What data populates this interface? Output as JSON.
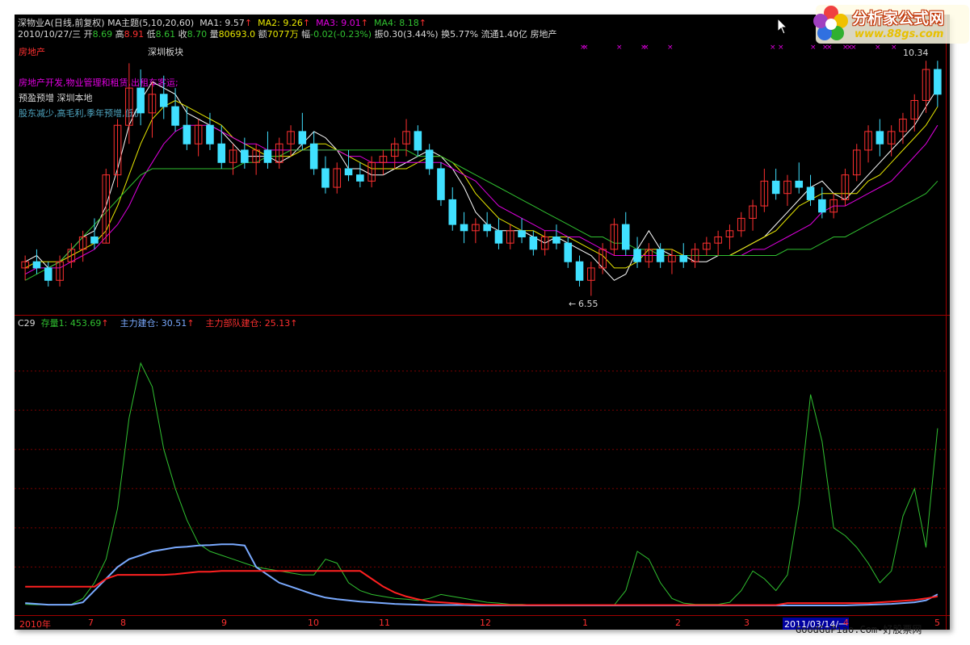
{
  "header": {
    "line1": [
      {
        "text": "深物业A(日线,前复权)",
        "color": "#d8d8d8"
      },
      {
        "text": "MA主题(5,10,20,60)",
        "color": "#d8d8d8"
      },
      {
        "text": "MA1: 9.57",
        "color": "#d8d8d8"
      },
      {
        "text": "MA2: 9.26",
        "color": "#e8e800"
      },
      {
        "text": "MA3: 9.01",
        "color": "#e000e0"
      },
      {
        "text": "MA4: 8.18",
        "color": "#30c030"
      }
    ],
    "line2": {
      "date": "2010/10/27/三",
      "open_label": "开",
      "open": "8.69",
      "high_label": "高",
      "high": "8.91",
      "low_label": "低",
      "low": "8.61",
      "close_label": "收",
      "close": "8.70",
      "vol_label": "量",
      "vol": "80693.0",
      "amt_label": "额",
      "amt": "7077万",
      "chg_label": "幅",
      "chg": "-0.02(-0.23%)",
      "amp_label": "振",
      "amp": "0.30(3.44%)",
      "turn_label": "换",
      "turn": "5.77%",
      "float_label": "流通",
      "float": "1.40亿",
      "industry": "房地产"
    }
  },
  "tags": {
    "sector": "房地产",
    "board": "深圳板块",
    "business": "房地产开发,物业管理和租赁,出租车客运;",
    "forecast": "预盈预增 深圳本地",
    "notes": "股东减少,高毛利,季年预增,低价"
  },
  "price_labels": {
    "high": "10.34",
    "low": "6.55"
  },
  "indicator_header": {
    "name": "C29",
    "stock_label": "存量1: 453.69",
    "main_label": "主力建仓: 30.51",
    "dept_label": "主力部队建仓: 25.13"
  },
  "x_axis": {
    "labels": [
      {
        "text": "2010年",
        "pos": 0
      },
      {
        "text": "7",
        "pos": 85
      },
      {
        "text": "8",
        "pos": 125
      },
      {
        "text": "9",
        "pos": 250
      },
      {
        "text": "10",
        "pos": 357
      },
      {
        "text": "11",
        "pos": 445
      },
      {
        "text": "12",
        "pos": 570
      },
      {
        "text": "1",
        "pos": 697
      },
      {
        "text": "2",
        "pos": 812
      },
      {
        "text": "3",
        "pos": 897
      },
      {
        "text": "2011/03/14/一",
        "pos": 945
      },
      {
        "text": "4",
        "pos": 1020
      },
      {
        "text": "5",
        "pos": 1133
      }
    ]
  },
  "logo": {
    "title": "分析家公式网",
    "url": "www.88gs.com"
  },
  "watermark": "GoodGuPiao.Com-好股票网",
  "colors": {
    "up": "#ff3030",
    "down": "#40e0ff",
    "ma1": "#ffffff",
    "ma2": "#e8e800",
    "ma3": "#e000e0",
    "ma4": "#30c030",
    "ind_stock": "#30c030",
    "ind_main": "#7aaaff",
    "ind_dept": "#ff2020",
    "grid": "#a00000"
  },
  "chart_data": [
    {
      "type": "candlestick",
      "title": "深物业A(日线,前复权)",
      "series": [
        {
          "name": "MA1",
          "values": [
            7.1,
            7.2,
            7.0,
            7.1,
            7.3,
            7.5,
            7.6,
            8.0,
            8.6,
            9.3,
            9.7,
            10.0,
            9.9,
            9.8,
            9.5,
            9.4,
            9.3,
            9.2,
            9.0,
            8.8,
            8.8,
            8.8,
            8.7,
            8.8,
            9.0,
            9.2,
            9.1,
            8.9,
            8.6,
            8.6,
            8.5,
            8.5,
            8.6,
            8.7,
            8.8,
            8.9,
            8.8,
            8.6,
            8.3,
            7.9,
            7.7,
            7.6,
            7.6,
            7.6,
            7.5,
            7.4,
            7.5,
            7.4,
            7.3,
            7.2,
            7.0,
            6.8,
            6.9,
            7.3,
            7.6,
            7.3,
            7.2,
            7.2,
            7.1,
            7.1,
            7.2,
            7.2,
            7.3,
            7.4,
            7.5,
            7.7,
            7.9,
            8.1,
            8.3,
            8.4,
            8.2,
            8.1,
            8.3,
            8.5,
            8.7,
            8.9,
            9.1,
            9.3,
            9.6,
            9.9
          ]
        },
        {
          "name": "MA2",
          "values": [
            7.0,
            7.1,
            7.1,
            7.1,
            7.2,
            7.3,
            7.4,
            7.6,
            8.0,
            8.5,
            9.0,
            9.4,
            9.6,
            9.7,
            9.6,
            9.5,
            9.4,
            9.3,
            9.1,
            9.0,
            8.9,
            8.8,
            8.8,
            8.8,
            8.9,
            9.0,
            9.0,
            8.9,
            8.8,
            8.7,
            8.6,
            8.6,
            8.6,
            8.6,
            8.7,
            8.8,
            8.8,
            8.7,
            8.5,
            8.2,
            8.0,
            7.8,
            7.7,
            7.6,
            7.6,
            7.5,
            7.5,
            7.5,
            7.4,
            7.3,
            7.2,
            7.0,
            7.0,
            7.1,
            7.3,
            7.3,
            7.3,
            7.2,
            7.2,
            7.2,
            7.2,
            7.2,
            7.3,
            7.4,
            7.5,
            7.6,
            7.8,
            8.0,
            8.1,
            8.2,
            8.2,
            8.2,
            8.2,
            8.4,
            8.5,
            8.7,
            8.9,
            9.1,
            9.3,
            9.6
          ]
        },
        {
          "name": "MA3",
          "values": [
            6.9,
            7.0,
            7.0,
            7.0,
            7.1,
            7.2,
            7.3,
            7.5,
            7.7,
            8.0,
            8.4,
            8.7,
            9.0,
            9.2,
            9.3,
            9.3,
            9.3,
            9.2,
            9.1,
            9.0,
            9.0,
            8.9,
            8.9,
            8.9,
            8.9,
            8.9,
            8.9,
            8.9,
            8.8,
            8.8,
            8.7,
            8.7,
            8.7,
            8.7,
            8.7,
            8.7,
            8.7,
            8.6,
            8.5,
            8.4,
            8.2,
            8.0,
            7.9,
            7.8,
            7.7,
            7.6,
            7.6,
            7.5,
            7.5,
            7.4,
            7.3,
            7.2,
            7.2,
            7.2,
            7.2,
            7.2,
            7.2,
            7.2,
            7.2,
            7.2,
            7.2,
            7.2,
            7.2,
            7.3,
            7.3,
            7.4,
            7.5,
            7.6,
            7.7,
            7.9,
            8.0,
            8.0,
            8.1,
            8.2,
            8.3,
            8.4,
            8.6,
            8.8,
            9.0,
            9.3
          ]
        },
        {
          "name": "MA4",
          "values": [
            6.8,
            6.9,
            7.0,
            7.1,
            7.3,
            7.5,
            7.7,
            7.9,
            8.1,
            8.3,
            8.5,
            8.6,
            8.6,
            8.6,
            8.6,
            8.6,
            8.6,
            8.6,
            8.6,
            8.7,
            8.7,
            8.8,
            8.8,
            8.9,
            8.9,
            8.9,
            8.9,
            8.9,
            8.9,
            8.9,
            8.9,
            8.9,
            8.9,
            8.9,
            8.8,
            8.8,
            8.8,
            8.7,
            8.6,
            8.5,
            8.4,
            8.3,
            8.2,
            8.1,
            8.0,
            7.9,
            7.8,
            7.7,
            7.6,
            7.5,
            7.5,
            7.4,
            7.4,
            7.3,
            7.3,
            7.2,
            7.2,
            7.2,
            7.2,
            7.2,
            7.2,
            7.2,
            7.2,
            7.2,
            7.2,
            7.2,
            7.3,
            7.3,
            7.3,
            7.4,
            7.5,
            7.5,
            7.6,
            7.7,
            7.8,
            7.9,
            8.0,
            8.1,
            8.2,
            8.4
          ]
        }
      ],
      "candles": [
        [
          7.0,
          7.2,
          6.8,
          7.1
        ],
        [
          7.1,
          7.3,
          6.9,
          7.0
        ],
        [
          7.0,
          7.1,
          6.7,
          6.8
        ],
        [
          6.8,
          7.2,
          6.7,
          7.1
        ],
        [
          7.1,
          7.4,
          7.0,
          7.3
        ],
        [
          7.3,
          7.6,
          7.1,
          7.5
        ],
        [
          7.5,
          7.8,
          7.3,
          7.4
        ],
        [
          7.4,
          8.6,
          7.4,
          8.5
        ],
        [
          8.5,
          9.4,
          8.3,
          9.3
        ],
        [
          9.3,
          10.3,
          9.0,
          9.9
        ],
        [
          9.9,
          10.2,
          9.3,
          9.5
        ],
        [
          9.5,
          10.0,
          9.1,
          9.8
        ],
        [
          9.8,
          10.1,
          9.4,
          9.6
        ],
        [
          9.6,
          9.9,
          9.2,
          9.3
        ],
        [
          9.3,
          9.6,
          8.9,
          9.0
        ],
        [
          9.0,
          9.4,
          8.8,
          9.3
        ],
        [
          9.3,
          9.5,
          8.9,
          9.0
        ],
        [
          9.0,
          9.3,
          8.6,
          8.7
        ],
        [
          8.7,
          9.0,
          8.5,
          8.9
        ],
        [
          8.9,
          9.1,
          8.6,
          8.7
        ],
        [
          8.7,
          9.0,
          8.5,
          8.9
        ],
        [
          8.9,
          9.2,
          8.6,
          8.7
        ],
        [
          8.7,
          9.1,
          8.6,
          9.0
        ],
        [
          9.0,
          9.3,
          8.8,
          9.2
        ],
        [
          9.2,
          9.5,
          8.9,
          9.0
        ],
        [
          9.0,
          9.2,
          8.5,
          8.6
        ],
        [
          8.6,
          8.8,
          8.2,
          8.3
        ],
        [
          8.3,
          8.7,
          8.2,
          8.6
        ],
        [
          8.6,
          8.9,
          8.4,
          8.5
        ],
        [
          8.5,
          8.7,
          8.3,
          8.4
        ],
        [
          8.4,
          8.8,
          8.3,
          8.7
        ],
        [
          8.7,
          8.9,
          8.5,
          8.8
        ],
        [
          8.8,
          9.1,
          8.6,
          9.0
        ],
        [
          9.0,
          9.4,
          8.8,
          9.2
        ],
        [
          9.2,
          9.3,
          8.8,
          8.9
        ],
        [
          8.9,
          9.0,
          8.5,
          8.6
        ],
        [
          8.6,
          8.7,
          8.0,
          8.1
        ],
        [
          8.1,
          8.3,
          7.6,
          7.7
        ],
        [
          7.7,
          7.9,
          7.4,
          7.6
        ],
        [
          7.6,
          7.8,
          7.4,
          7.7
        ],
        [
          7.7,
          7.9,
          7.5,
          7.6
        ],
        [
          7.6,
          7.8,
          7.3,
          7.4
        ],
        [
          7.4,
          7.7,
          7.3,
          7.6
        ],
        [
          7.6,
          7.8,
          7.4,
          7.5
        ],
        [
          7.5,
          7.6,
          7.2,
          7.3
        ],
        [
          7.3,
          7.6,
          7.2,
          7.5
        ],
        [
          7.5,
          7.7,
          7.3,
          7.4
        ],
        [
          7.4,
          7.5,
          7.0,
          7.1
        ],
        [
          7.1,
          7.2,
          6.7,
          6.8
        ],
        [
          6.8,
          7.1,
          6.55,
          7.0
        ],
        [
          7.0,
          7.4,
          6.9,
          7.3
        ],
        [
          7.3,
          7.8,
          7.2,
          7.7
        ],
        [
          7.7,
          7.9,
          7.2,
          7.3
        ],
        [
          7.3,
          7.5,
          7.0,
          7.1
        ],
        [
          7.1,
          7.4,
          7.0,
          7.3
        ],
        [
          7.3,
          7.4,
          7.0,
          7.1
        ],
        [
          7.1,
          7.3,
          6.9,
          7.2
        ],
        [
          7.2,
          7.4,
          7.0,
          7.1
        ],
        [
          7.1,
          7.4,
          7.0,
          7.3
        ],
        [
          7.3,
          7.5,
          7.2,
          7.4
        ],
        [
          7.4,
          7.6,
          7.2,
          7.5
        ],
        [
          7.5,
          7.7,
          7.3,
          7.6
        ],
        [
          7.6,
          7.9,
          7.5,
          7.8
        ],
        [
          7.8,
          8.1,
          7.6,
          8.0
        ],
        [
          8.0,
          8.6,
          7.9,
          8.4
        ],
        [
          8.4,
          8.6,
          8.1,
          8.2
        ],
        [
          8.2,
          8.5,
          8.0,
          8.4
        ],
        [
          8.4,
          8.7,
          8.2,
          8.3
        ],
        [
          8.3,
          8.5,
          8.0,
          8.1
        ],
        [
          8.1,
          8.3,
          7.8,
          7.9
        ],
        [
          7.9,
          8.2,
          7.8,
          8.1
        ],
        [
          8.1,
          8.6,
          8.0,
          8.5
        ],
        [
          8.5,
          9.0,
          8.4,
          8.9
        ],
        [
          8.9,
          9.3,
          8.7,
          9.2
        ],
        [
          9.2,
          9.4,
          8.8,
          9.0
        ],
        [
          9.0,
          9.3,
          8.8,
          9.2
        ],
        [
          9.2,
          9.5,
          9.0,
          9.4
        ],
        [
          9.4,
          9.8,
          9.2,
          9.7
        ],
        [
          9.7,
          10.34,
          9.5,
          10.2
        ],
        [
          10.2,
          10.34,
          9.6,
          9.8
        ]
      ]
    },
    {
      "type": "line",
      "title": "C29",
      "series": [
        {
          "name": "存量1",
          "values": [
            5,
            4,
            4,
            4,
            5,
            20,
            60,
            120,
            250,
            480,
            620,
            560,
            400,
            300,
            220,
            160,
            140,
            130,
            120,
            110,
            100,
            95,
            90,
            85,
            80,
            80,
            120,
            110,
            60,
            40,
            30,
            25,
            20,
            18,
            15,
            20,
            30,
            25,
            20,
            15,
            10,
            8,
            5,
            5,
            3,
            3,
            3,
            3,
            2,
            2,
            2,
            3,
            40,
            140,
            120,
            60,
            20,
            8,
            5,
            5,
            5,
            10,
            40,
            90,
            70,
            40,
            80,
            260,
            540,
            420,
            200,
            180,
            150,
            110,
            60,
            90,
            230,
            300,
            150,
            453.69
          ]
        },
        {
          "name": "主力建仓",
          "values": [
            8,
            6,
            4,
            4,
            4,
            10,
            40,
            70,
            100,
            120,
            130,
            140,
            145,
            150,
            152,
            155,
            156,
            158,
            158,
            155,
            100,
            80,
            60,
            50,
            40,
            30,
            22,
            18,
            15,
            12,
            10,
            8,
            6,
            5,
            4,
            3,
            3,
            3,
            3,
            2,
            2,
            2,
            2,
            2,
            2,
            2,
            2,
            2,
            2,
            2,
            2,
            2,
            2,
            2,
            2,
            2,
            2,
            2,
            2,
            2,
            2,
            2,
            2,
            2,
            2,
            2,
            2,
            2,
            2,
            2,
            2,
            2,
            3,
            4,
            5,
            6,
            8,
            10,
            15,
            30.51
          ]
        },
        {
          "name": "主力部队建仓",
          "values": [
            50,
            50,
            50,
            50,
            50,
            50,
            50,
            70,
            80,
            80,
            80,
            80,
            80,
            82,
            85,
            88,
            88,
            90,
            90,
            90,
            90,
            90,
            90,
            90,
            90,
            90,
            90,
            90,
            90,
            90,
            70,
            50,
            35,
            25,
            18,
            12,
            10,
            8,
            6,
            5,
            4,
            4,
            3,
            3,
            3,
            3,
            3,
            3,
            3,
            3,
            3,
            3,
            3,
            3,
            3,
            3,
            3,
            3,
            3,
            3,
            3,
            3,
            3,
            3,
            3,
            3,
            8,
            8,
            8,
            8,
            8,
            8,
            8,
            8,
            10,
            12,
            14,
            16,
            20,
            25.13
          ]
        }
      ]
    }
  ]
}
